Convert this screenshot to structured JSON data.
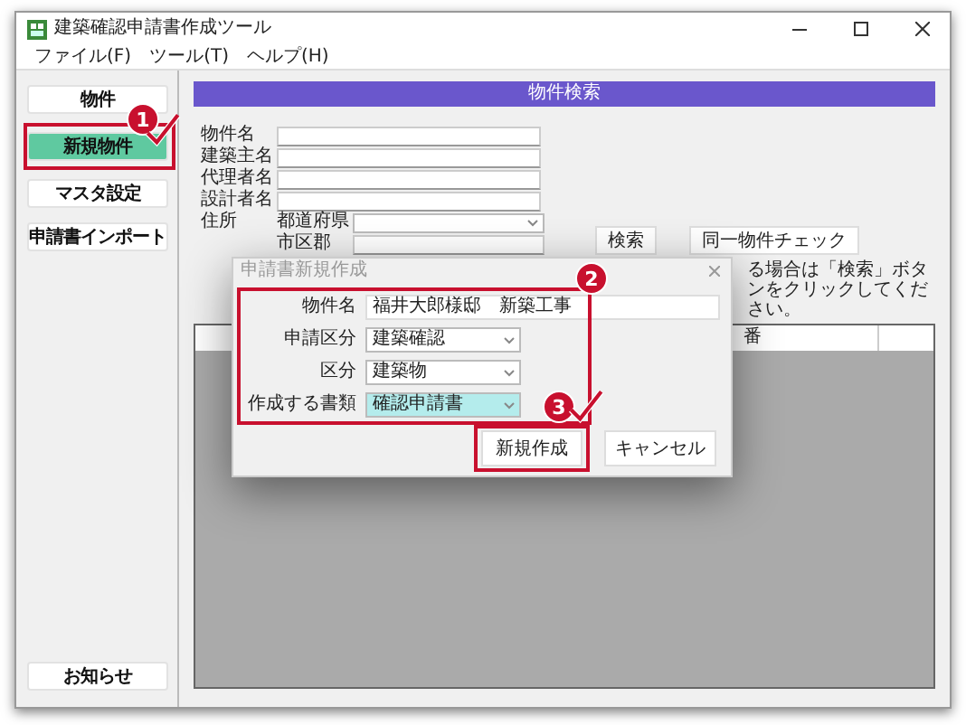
{
  "window": {
    "title": "建築確認申請書作成ツール"
  },
  "menu": [
    "ファイル(F)",
    "ツール(T)",
    "ヘルプ(H)"
  ],
  "sidebar": {
    "buttons": [
      {
        "label": "物件",
        "selected": false
      },
      {
        "label": "新規物件",
        "selected": true
      },
      {
        "label": "マスタ設定",
        "selected": false
      },
      {
        "label": "申請書インポート",
        "selected": false
      }
    ],
    "notice_button": "お知らせ"
  },
  "search": {
    "header": "物件検索",
    "fields": [
      {
        "label": "物件名"
      },
      {
        "label": "建築主名"
      },
      {
        "label": "代理者名"
      },
      {
        "label": "設計者名"
      }
    ],
    "address": {
      "label": "住所",
      "prefecture_label": "都道府県",
      "city_label": "市区郡"
    },
    "buttons": [
      "検索",
      "同一物件チェック"
    ],
    "hint": "る場合は「検索」ボタンをクリックしてください。",
    "table": {
      "columns": [
        "番"
      ]
    }
  },
  "dialog": {
    "title": "申請書新規作成",
    "fields": [
      {
        "label": "物件名",
        "kind": "text",
        "value": "福井大郎様邸　新築工事",
        "selected": false
      },
      {
        "label": "申請区分",
        "kind": "select",
        "value": "建築確認",
        "selected": false
      },
      {
        "label": "区分",
        "kind": "select",
        "value": "建築物",
        "selected": false
      },
      {
        "label": "作成する書類",
        "kind": "select",
        "value": "確認申請書",
        "selected": true
      }
    ],
    "buttons": [
      "新規作成",
      "キャンセル"
    ]
  },
  "annotations": [
    {
      "number": "1"
    },
    {
      "number": "2"
    },
    {
      "number": "3"
    }
  ]
}
